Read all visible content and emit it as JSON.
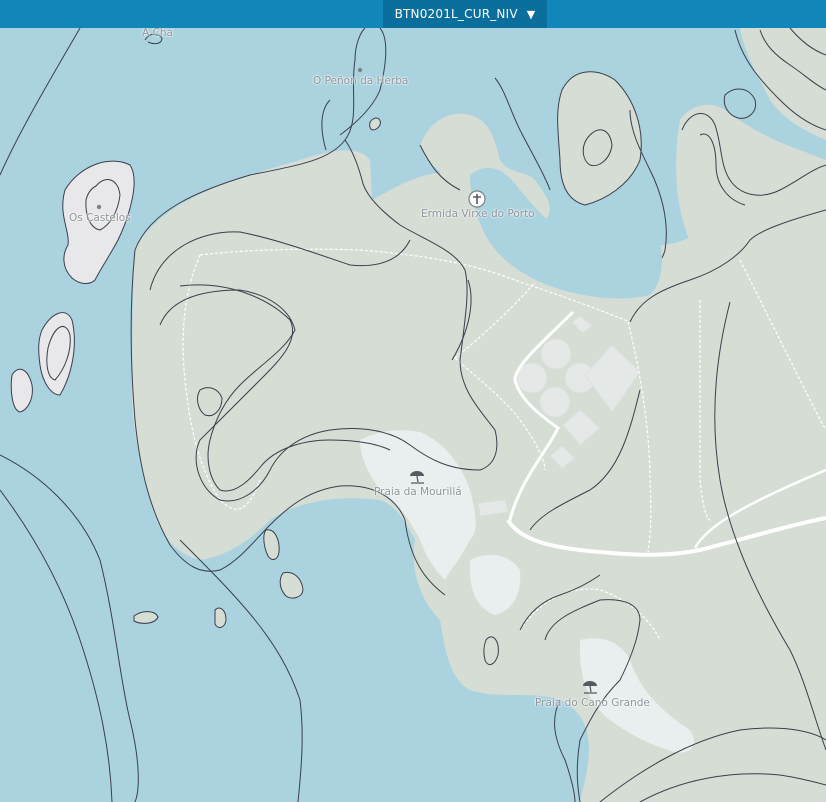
{
  "toolbar": {
    "layer_select_value": "BTN0201L_CUR_NIV",
    "dropdown_icon": "▼"
  },
  "map": {
    "colors": {
      "water": "#aad3df",
      "land": "#d5ddd5",
      "beach": "#e9eeee",
      "rock": "#e8e7ea",
      "contour": "#3a3f4b",
      "path": "#ffffff",
      "toolbar": "#1286b8"
    },
    "labels": {
      "a_cha": "A Chá",
      "penon": "O Peñón da Herba",
      "castelos": "Os Castelos",
      "ermida": "Ermida Virxe do Porto",
      "mourilla": "Praia da Mourillá",
      "cano": "Praia do Cano Grande"
    },
    "icons": [
      "chapel-icon",
      "beach-umbrella-icon",
      "beach-umbrella-icon",
      "peak-dot-icon",
      "peak-dot-icon"
    ]
  }
}
